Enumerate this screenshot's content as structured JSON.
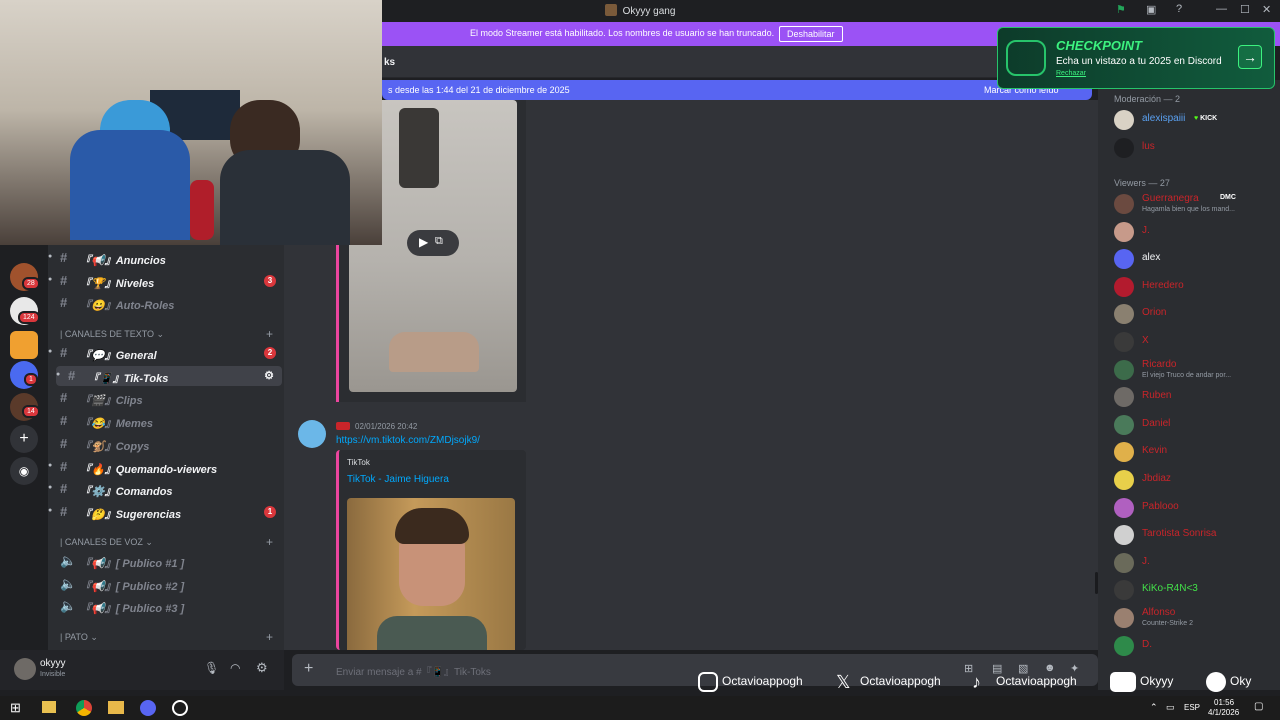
{
  "window": {
    "title": "Okyyy gang"
  },
  "banner": {
    "text": "El modo Streamer está habilitado. Los nombres de usuario se han truncado.",
    "button": "Deshabilitar"
  },
  "header": {
    "channel_partial": "ks"
  },
  "new_messages": {
    "text": "s desde las 1:44 del 21 de diciembre de 2025",
    "action": "Marcar como leído"
  },
  "checkpoint": {
    "title": "CHECKPOINT",
    "subtitle": "Echa un vistazo a tu 2025 en Discord",
    "dismiss": "Rechazar"
  },
  "rail": {
    "badges": [
      "28",
      "124",
      "1",
      "14"
    ],
    "add_icon": "plus-icon",
    "explore_icon": "compass-icon"
  },
  "sidebar": {
    "channels_top": [
      {
        "label": "『📢』Anuncios",
        "muted": false,
        "badge": ""
      },
      {
        "label": "『🏆』Niveles",
        "muted": false,
        "badge": "3"
      },
      {
        "label": "『😀』Auto-Roles",
        "muted": true,
        "badge": ""
      }
    ],
    "cat_text": "| CANALES DE TEXTO",
    "channels_text": [
      {
        "label": "『💬』General",
        "muted": false,
        "badge": "2"
      },
      {
        "label": "『📱』Tik-Toks",
        "muted": false,
        "badge": "",
        "selected": true
      },
      {
        "label": "『🎬』Clips",
        "muted": true,
        "badge": ""
      },
      {
        "label": "『😂』Memes",
        "muted": true,
        "badge": ""
      },
      {
        "label": "『🐒』Copys",
        "muted": true,
        "badge": ""
      },
      {
        "label": "『🔥』Quemando-viewers",
        "muted": false,
        "badge": ""
      },
      {
        "label": "『⚙️』Comandos",
        "muted": false,
        "badge": ""
      },
      {
        "label": "『🤔』Sugerencias",
        "muted": false,
        "badge": "1"
      }
    ],
    "cat_voice": "| CANALES DE VOZ",
    "channels_voice": [
      {
        "label": "『📢』[ Publico #1 ]"
      },
      {
        "label": "『📢』[ Publico #2 ]"
      },
      {
        "label": "『📢』[ Publico #3 ]"
      }
    ],
    "cat_pato": "| PATO"
  },
  "user": {
    "name": "okyyy",
    "status": "Invisible"
  },
  "message": {
    "timestamp": "02/01/2026 20:42",
    "link": "https://vm.tiktok.com/ZMDjsojk9/",
    "embed_provider": "TikTok",
    "embed_title": "TikTok - Jaime Higuera"
  },
  "composer": {
    "placeholder": "Enviar mensaje a #『📱』Tik-Toks"
  },
  "members": {
    "mod_header": "Moderación — 2",
    "mods": [
      {
        "name": "alexispaiii",
        "tag": "KICK",
        "color": "#5aa0f0",
        "avatar": "#d9d2c5"
      },
      {
        "name": "lus",
        "tag": "",
        "color": "#c9252a",
        "avatar": "#1e1f22"
      }
    ],
    "viewers_header": "Viewers — 27",
    "viewers": [
      {
        "name": "Guerranegra",
        "sub": "Hagamla bien que los mand...",
        "color": "#c9252a",
        "avatar": "#6b4a40",
        "tag": "DMC"
      },
      {
        "name": "J.",
        "sub": "",
        "color": "#c9252a",
        "avatar": "#c79a8a"
      },
      {
        "name": "alex",
        "sub": "",
        "color": "#f2f3f5",
        "avatar": "#5865f2"
      },
      {
        "name": "Heredero",
        "sub": "",
        "color": "#c9252a",
        "avatar": "#b31b2e"
      },
      {
        "name": "Orion",
        "sub": "",
        "color": "#c9252a",
        "avatar": "#8a8070"
      },
      {
        "name": "X",
        "sub": "",
        "color": "#c9252a",
        "avatar": "#3a3a3a"
      },
      {
        "name": "Ricardo",
        "sub": "El viejo Truco de andar por...",
        "color": "#c9252a",
        "avatar": "#3c6b4a"
      },
      {
        "name": "Ruben",
        "sub": "",
        "color": "#c9252a",
        "avatar": "#6e6a66"
      },
      {
        "name": "Daniel",
        "sub": "",
        "color": "#c9252a",
        "avatar": "#4a7a5a"
      },
      {
        "name": "Kevin",
        "sub": "",
        "color": "#c9252a",
        "avatar": "#e0b04a"
      },
      {
        "name": "Jbdiaz",
        "sub": "",
        "color": "#c9252a",
        "avatar": "#e8d04a"
      },
      {
        "name": "Pablooo",
        "sub": "",
        "color": "#c9252a",
        "avatar": "#b060c0"
      },
      {
        "name": "Tarotista Sonrisa",
        "sub": "",
        "color": "#c9252a",
        "avatar": "#d0d0d0"
      },
      {
        "name": "J.",
        "sub": "",
        "color": "#c9252a",
        "avatar": "#6a6a5a"
      },
      {
        "name": "KiKo-R4N<3",
        "sub": "",
        "color": "#43e049",
        "avatar": "#3a3a3a"
      },
      {
        "name": "Alfonso",
        "sub": "Counter-Strike 2",
        "color": "#c9252a",
        "avatar": "#9a8070"
      },
      {
        "name": "D.",
        "sub": "",
        "color": "#c9252a",
        "avatar": "#2e8a4a"
      }
    ]
  },
  "social": [
    {
      "icon": "instagram-icon",
      "handle": "Octavioappogh"
    },
    {
      "icon": "x-icon",
      "handle": "Octavioappogh"
    },
    {
      "icon": "tiktok-icon",
      "handle": "Octavioappogh"
    },
    {
      "icon": "youtube-icon",
      "handle": "Okyyy"
    },
    {
      "icon": "spotify-icon",
      "handle": "Oky"
    }
  ],
  "taskbar": {
    "lang": "ESP",
    "time": "01:56",
    "date": "4/1/2026"
  },
  "colors": {
    "blurple": "#5865f2",
    "streamer": "#9b52f5",
    "link": "#00a8fc",
    "red": "#da373c",
    "online": "#23a55a"
  }
}
